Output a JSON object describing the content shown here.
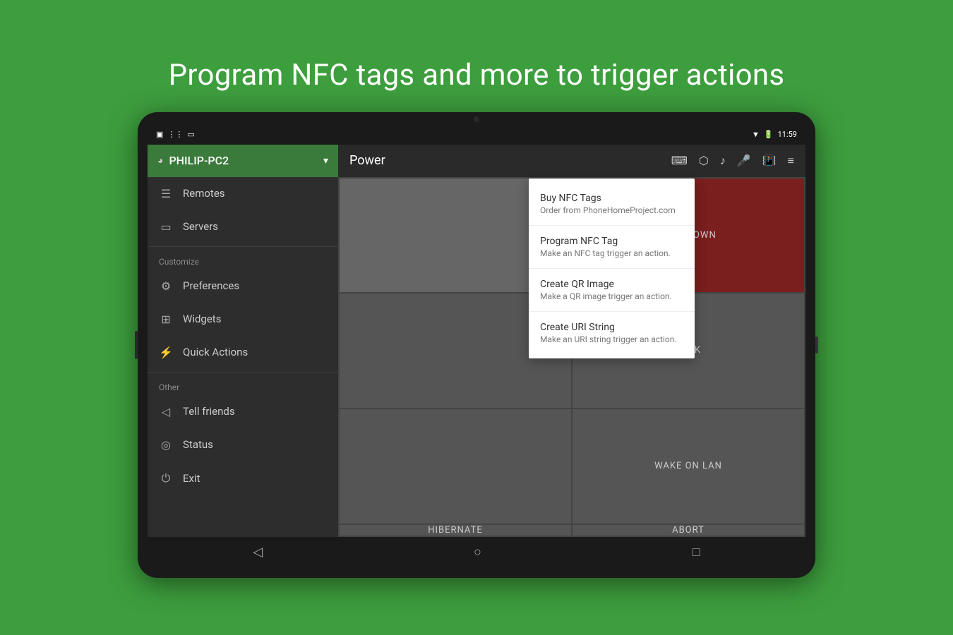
{
  "page": {
    "title": "Program NFC tags and more to trigger actions",
    "background_color": "#3d9e3d"
  },
  "status_bar": {
    "time": "11:59",
    "battery_icon": "🔋",
    "wifi_icon": "▼",
    "left_icons": [
      "▣",
      "⋮⋮",
      "▭"
    ]
  },
  "sidebar": {
    "header": {
      "device_name": "PHILIP-PC2",
      "wifi_icon": "wifi"
    },
    "items": [
      {
        "id": "remotes",
        "label": "Remotes",
        "icon": "☰"
      },
      {
        "id": "servers",
        "label": "Servers",
        "icon": "▭"
      }
    ],
    "customize_label": "Customize",
    "customize_items": [
      {
        "id": "preferences",
        "label": "Preferences",
        "icon": "⚙"
      },
      {
        "id": "widgets",
        "label": "Widgets",
        "icon": "⊞"
      },
      {
        "id": "quick-actions",
        "label": "Quick Actions",
        "icon": "⚡"
      }
    ],
    "other_label": "Other",
    "other_items": [
      {
        "id": "tell-friends",
        "label": "Tell friends",
        "icon": "◁"
      },
      {
        "id": "status",
        "label": "Status",
        "icon": "◎"
      },
      {
        "id": "exit",
        "label": "Exit",
        "icon": "⏻"
      }
    ]
  },
  "toolbar": {
    "title": "Power",
    "icons": [
      "keyboard",
      "mouse",
      "music",
      "mic",
      "phone",
      "menu"
    ]
  },
  "power_grid": {
    "cells": [
      {
        "id": "wake",
        "label": "",
        "style": "left-dim"
      },
      {
        "id": "shutdown",
        "label": "SHUTDOWN",
        "style": "red"
      },
      {
        "id": "left2",
        "label": "",
        "style": "normal"
      },
      {
        "id": "lock",
        "label": "LOCK",
        "style": "normal"
      },
      {
        "id": "left3",
        "label": "",
        "style": "normal"
      },
      {
        "id": "wake-on-lan",
        "label": "WAKE ON LAN",
        "style": "normal"
      },
      {
        "id": "hibernate",
        "label": "HIBERNATE",
        "style": "normal"
      },
      {
        "id": "abort",
        "label": "ABORT",
        "style": "normal"
      }
    ]
  },
  "popup_menu": {
    "items": [
      {
        "id": "buy-nfc-tags",
        "title": "Buy NFC Tags",
        "subtitle": "Order from PhoneHomeProject.com"
      },
      {
        "id": "program-nfc-tag",
        "title": "Program NFC Tag",
        "subtitle": "Make an NFC tag trigger an action."
      },
      {
        "id": "create-qr-image",
        "title": "Create QR Image",
        "subtitle": "Make a QR image trigger an action."
      },
      {
        "id": "create-uri-string",
        "title": "Create URI String",
        "subtitle": "Make an URI string trigger an action."
      }
    ]
  },
  "nav_bar": {
    "back_label": "◁",
    "home_label": "○",
    "recent_label": "□"
  }
}
